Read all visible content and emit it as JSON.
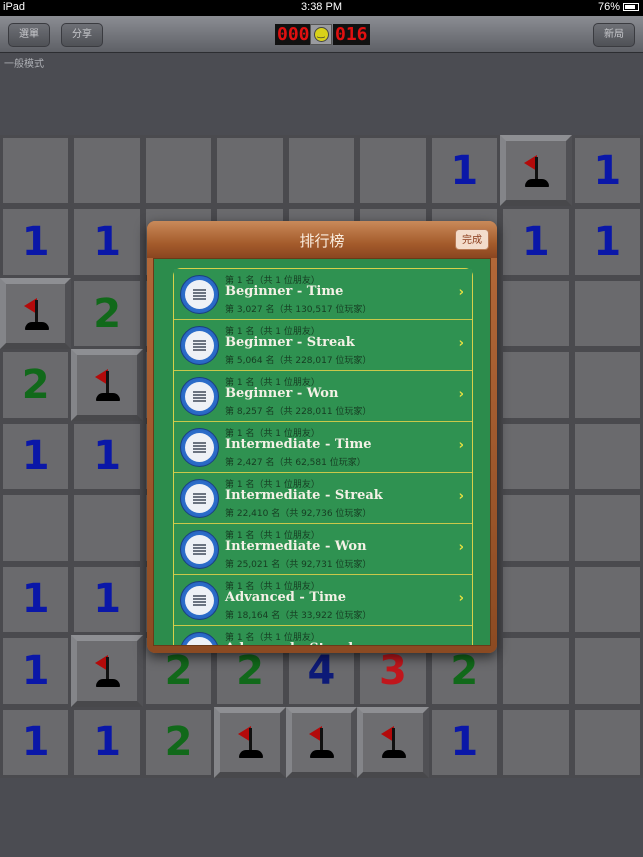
{
  "status_bar": {
    "device": "iPad",
    "time": "3:38 PM",
    "battery": "76%"
  },
  "toolbar": {
    "menu_label": "選單",
    "share_label": "分享",
    "new_game_label": "新局",
    "mine_counter": "000",
    "timer": "016",
    "face_icon": "smiley-icon"
  },
  "mode_label": "一般模式",
  "board": {
    "rows": [
      [
        "",
        "",
        "",
        "",
        "",
        "",
        "1",
        "flag",
        "1"
      ],
      [
        "1",
        "1",
        "",
        "",
        "",
        "",
        "",
        "1",
        "1"
      ],
      [
        "flag",
        "2",
        "",
        "",
        "",
        "",
        "",
        "",
        ""
      ],
      [
        "2",
        "flag",
        "",
        "",
        "",
        "",
        "",
        "",
        ""
      ],
      [
        "1",
        "1",
        "",
        "",
        "",
        "",
        "",
        "",
        ""
      ],
      [
        "",
        "",
        "",
        "",
        "",
        "",
        "",
        "",
        ""
      ],
      [
        "1",
        "1",
        "",
        "",
        "",
        "",
        "",
        "",
        ""
      ],
      [
        "1",
        "flag",
        "2",
        "2",
        "4",
        "3",
        "2",
        "",
        ""
      ],
      [
        "1",
        "1",
        "2",
        "flag",
        "flag",
        "flag",
        "1",
        "",
        ""
      ]
    ],
    "number_colors": {
      "1": "#0a17a8",
      "2": "#11691a",
      "3": "#c0161c",
      "4": "#0d1a78"
    }
  },
  "leaderboard": {
    "title": "排行榜",
    "done_label": "完成",
    "items": [
      {
        "friends": "第 1 名（共 1 位朋友）",
        "title": "Beginner - Time",
        "rank": "第 3,027 名（共 130,517 位玩家）"
      },
      {
        "friends": "第 1 名（共 1 位朋友）",
        "title": "Beginner - Streak",
        "rank": "第 5,064 名（共 228,017 位玩家）"
      },
      {
        "friends": "第 1 名（共 1 位朋友）",
        "title": "Beginner - Won",
        "rank": "第 8,257 名（共 228,011 位玩家）"
      },
      {
        "friends": "第 1 名（共 1 位朋友）",
        "title": "Intermediate - Time",
        "rank": "第 2,427 名（共 62,581 位玩家）"
      },
      {
        "friends": "第 1 名（共 1 位朋友）",
        "title": "Intermediate - Streak",
        "rank": "第 22,410 名（共 92,736 位玩家）"
      },
      {
        "friends": "第 1 名（共 1 位朋友）",
        "title": "Intermediate - Won",
        "rank": "第 25,021 名（共 92,731 位玩家）"
      },
      {
        "friends": "第 1 名（共 1 位朋友）",
        "title": "Advanced - Time",
        "rank": "第 18,164 名（共 33,922 位玩家）"
      },
      {
        "friends": "第 1 名（共 1 位朋友）",
        "title": "Advanced - Streak",
        "rank": ""
      }
    ]
  }
}
